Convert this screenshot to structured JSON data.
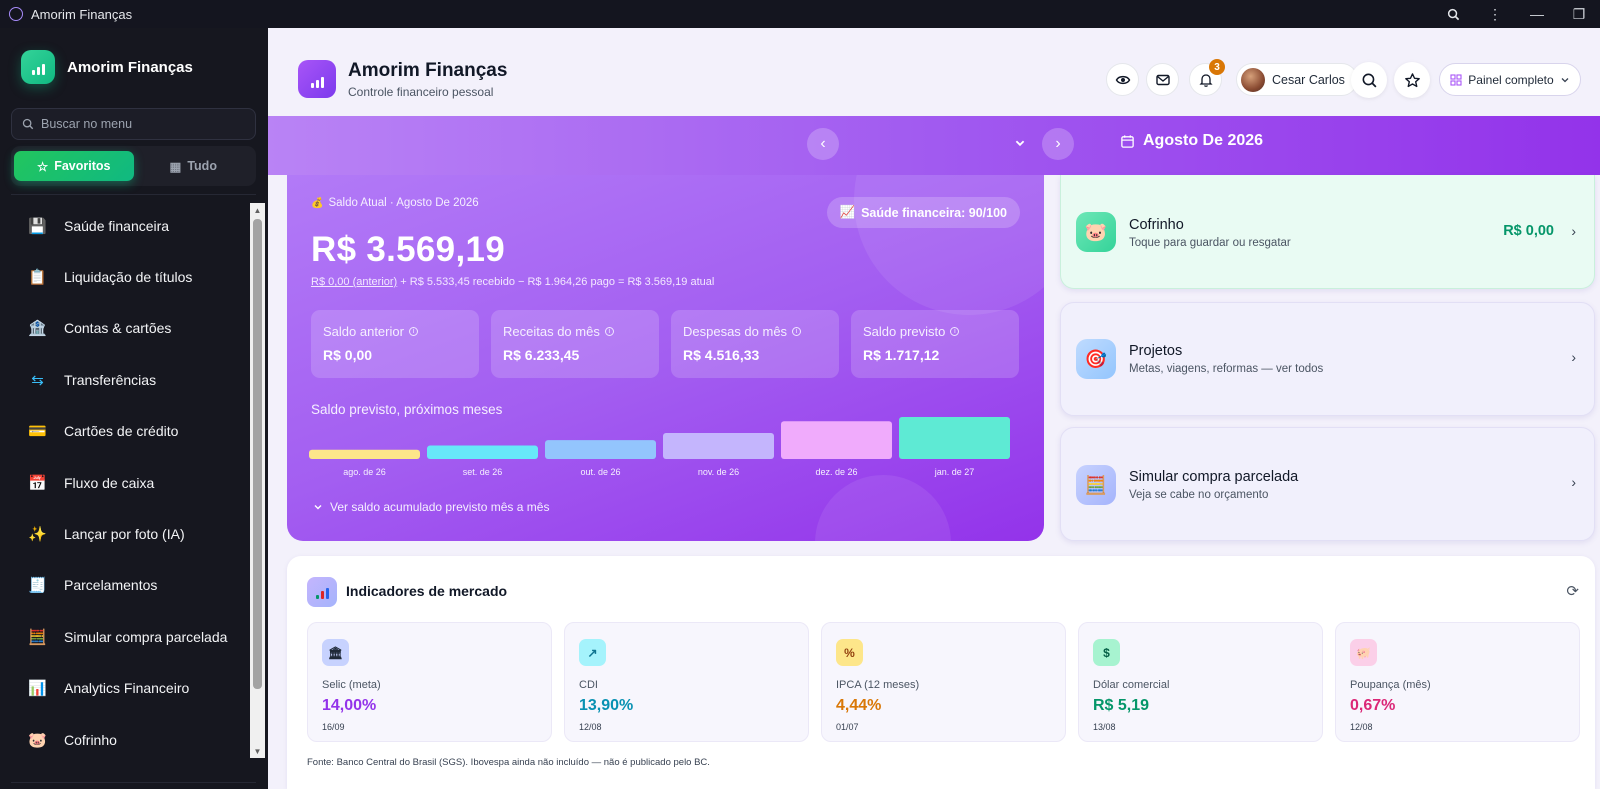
{
  "titlebar": {
    "title": "Amorim Finanças",
    "zoom_icon": "zoom-icon",
    "menu_icon": "kebab-menu-icon",
    "minimize_icon": "minimize-icon",
    "restore_icon": "restore-icon"
  },
  "sidebar": {
    "brand": "Amorim Finanças",
    "search_placeholder": "Buscar no menu",
    "tabs": [
      {
        "label": "Favoritos",
        "active": true
      },
      {
        "label": "Tudo",
        "active": false
      }
    ],
    "items": [
      {
        "label": "Saúde financeira",
        "icon": "💾",
        "bg": "#3a2f2a"
      },
      {
        "label": "Liquidação de títulos",
        "icon": "📋",
        "bg": "#3b2a2a"
      },
      {
        "label": "Contas & cartões",
        "icon": "🏦",
        "bg": "#263140"
      },
      {
        "label": "Transferências",
        "icon": "⇆",
        "bg": "#203040"
      },
      {
        "label": "Cartões de crédito",
        "icon": "💳",
        "bg": "#22303f"
      },
      {
        "label": "Fluxo de caixa",
        "icon": "📅",
        "bg": "#24304a"
      },
      {
        "label": "Lançar por foto (IA)",
        "icon": "✨",
        "bg": "#3a2f22"
      },
      {
        "label": "Parcelamentos",
        "icon": "🧾",
        "bg": "#263038"
      },
      {
        "label": "Simular compra parcelada",
        "icon": "🧮",
        "bg": "#3a2c24"
      },
      {
        "label": "Analytics Financeiro",
        "icon": "📊",
        "bg": "#332338"
      },
      {
        "label": "Cofrinho",
        "icon": "🐷",
        "bg": "#3a2c20"
      }
    ]
  },
  "header": {
    "title": "Amorim Finanças",
    "subtitle": "Controle financeiro pessoal",
    "notifications": "3",
    "user": "Cesar Carlos",
    "panel": "Painel completo"
  },
  "month": {
    "label": "Agosto De 2026"
  },
  "balance": {
    "label": "Saldo Atual · Agosto De 2026",
    "health": "Saúde financeira: 90/100",
    "value": "R$ 3.569,19",
    "formula_prev": "R$ 0,00 (anterior)",
    "formula_rest": " + R$ 5.533,45 recebido − R$ 1.964,26 pago = R$ 3.569,19 atual",
    "stats": [
      {
        "label": "Saldo anterior",
        "value": "R$ 0,00"
      },
      {
        "label": "Receitas do mês",
        "value": "R$ 6.233,45"
      },
      {
        "label": "Despesas do mês",
        "value": "R$ 4.516,33"
      },
      {
        "label": "Saldo previsto",
        "value": "R$ 1.717,12"
      }
    ],
    "projection_title": "Saldo previsto, próximos meses",
    "more_link": "Ver saldo acumulado previsto mês a mês"
  },
  "chart_data": {
    "type": "bar",
    "categories": [
      "ago. de 26",
      "set. de 26",
      "out. de 26",
      "nov. de 26",
      "dez. de 26",
      "jan. de 27"
    ],
    "values": [
      0.22,
      0.32,
      0.45,
      0.62,
      0.9,
      1.0
    ],
    "colors": [
      "#fde68a",
      "#67e8f9",
      "#93c5fd",
      "#c4b5fd",
      "#f0abfc",
      "#5eead4"
    ],
    "title": "Saldo previsto, próximos meses",
    "xlabel": "",
    "ylabel": ""
  },
  "right_cards": [
    {
      "title": "Cofrinho",
      "subtitle": "Toque para guardar ou resgatar",
      "amount": "R$ 0,00",
      "icon": "🐷"
    },
    {
      "title": "Projetos",
      "subtitle": "Metas, viagens, reformas — ver todos",
      "icon": "🎯"
    },
    {
      "title": "Simular compra parcelada",
      "subtitle": "Veja se cabe no orçamento",
      "icon": "🧮"
    }
  ],
  "market": {
    "title": "Indicadores de mercado",
    "items": [
      {
        "label": "Selic (meta)",
        "value": "14,00%",
        "date": "16/09",
        "color": "#9333ea",
        "icon": "🏛",
        "icon_bg": "#c7d2fe"
      },
      {
        "label": "CDI",
        "value": "13,90%",
        "date": "12/08",
        "color": "#0891b2",
        "icon": "↗",
        "icon_bg": "#a5f3fc"
      },
      {
        "label": "IPCA (12 meses)",
        "value": "4,44%",
        "date": "01/07",
        "color": "#d97706",
        "icon": "%",
        "icon_bg": "#fde68a"
      },
      {
        "label": "Dólar comercial",
        "value": "R$ 5,19",
        "date": "13/08",
        "color": "#059669",
        "icon": "$",
        "icon_bg": "#a7f3d0"
      },
      {
        "label": "Poupança (mês)",
        "value": "0,67%",
        "date": "12/08",
        "color": "#db2777",
        "icon": "🐖",
        "icon_bg": "#fbcfe8"
      }
    ],
    "source": "Fonte: Banco Central do Brasil (SGS). Ibovespa ainda não incluído — não é publicado pelo BC."
  }
}
